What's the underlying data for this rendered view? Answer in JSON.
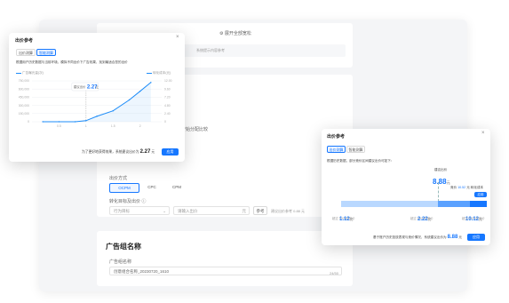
{
  "background": {
    "expand_all": "展开全部宽松",
    "hint": "系统提示内容参考",
    "section_label": "开始分配比较",
    "bid_method_label": "出价方式",
    "bid_methods": [
      "OCPM",
      "CPC",
      "CPM"
    ],
    "conversion_label": "转化目标及出价",
    "conversion_select": "行为目标",
    "price_placeholder": "请输入出价",
    "price_unit": "元",
    "reference_btn": "参考",
    "reference_hint": "建议出价参考 0.88 元",
    "ad_group_title": "广告组名称",
    "ad_group_label": "广告组名称",
    "ad_group_value": "创意组合名称_20230720_1610",
    "ad_group_counter": "24/50"
  },
  "dialog_left": {
    "title": "出价参考",
    "tabs": [
      "出价测算",
      "智能测算"
    ],
    "question": "根据用户历史数据与当前环境，模拟不同出价下广告效果，找到最适合您的出价",
    "legend_left": "广告曝光量(次)",
    "legend_right": "转化成本(元)",
    "y_left_ticks": [
      "750,000",
      "600,000",
      "450,000",
      "300,000",
      "150,000",
      "0"
    ],
    "y_right_ticks": [
      "12.00",
      "9.60",
      "7.20",
      "4.80",
      "2.40",
      "0"
    ],
    "x_ticks": [
      "0.5",
      "1",
      "1.5",
      "2"
    ],
    "tooltip_label": "建议出价",
    "tooltip_value": "2.27",
    "tooltip_unit": "元",
    "footer_text": "为了更好地获得效果，系统建议出价为",
    "footer_value": "2.27",
    "footer_unit": "元",
    "apply_btn": "应用"
  },
  "dialog_right": {
    "title": "出价参考",
    "tabs": [
      "出价测算",
      "智能测算"
    ],
    "question": "根据历史数据，部分竞价区间建议出价可如下：",
    "marker_label": "建议出价",
    "marker_value": "8.88",
    "marker_unit": "元",
    "side_label": "竞价",
    "side_value": "10.52",
    "side_suffix": "元 转化成本",
    "side_btn": "应用",
    "points": [
      {
        "value": "1.12",
        "unit": "元",
        "caption": "超过 10% 的竞价"
      },
      {
        "value": "2.22",
        "unit": "元",
        "caption": "超过 40% 的竞价"
      },
      {
        "value": "10.12",
        "unit": "元",
        "caption": "超过 90% 的竞价"
      }
    ],
    "footer_text": "基于账户历史投放表现与竞价情况，系统建议出价为",
    "footer_value": "8.88",
    "footer_unit": "元",
    "apply_btn": "应用"
  },
  "chart_data": {
    "type": "line",
    "x": [
      0.2,
      0.5,
      0.8,
      1.0,
      1.2,
      1.5,
      1.8,
      2.0,
      2.2
    ],
    "series": [
      {
        "name": "广告曝光量(次)",
        "values": [
          0,
          0,
          0,
          20000,
          100000,
          200000,
          400000,
          560000,
          720000
        ]
      }
    ],
    "ylim": [
      0,
      750000
    ]
  },
  "colors": {
    "accent": "#1677ff",
    "curve": "#1d8cf8",
    "bar_light": "#b9d8ff"
  }
}
